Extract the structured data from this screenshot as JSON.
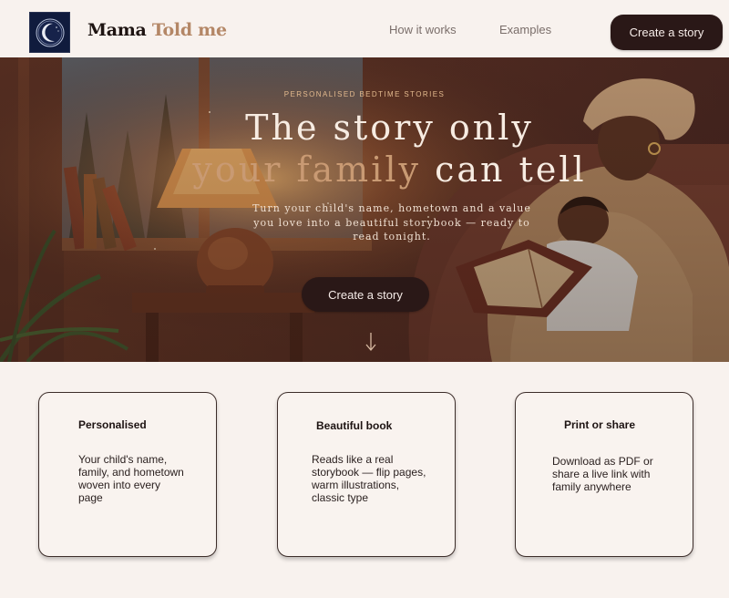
{
  "header": {
    "brand_part1": "Mama",
    "brand_part2": "Told me",
    "logo_icon": "crescent-moon-icon",
    "nav": [
      {
        "label": "How it works"
      },
      {
        "label": "Examples"
      }
    ],
    "cta_label": "Create a story"
  },
  "hero": {
    "eyebrow": "PERSONALISED BEDTIME STORIES",
    "headline_line1": "The story only",
    "headline_accent": "your family",
    "headline_rest": "can tell",
    "subtitle": "Turn your child's name, hometown and a value you love into a beautiful storybook — ready to read tonight.",
    "cta_label": "Create a story",
    "scroll_icon": "arrow-down-icon"
  },
  "features": [
    {
      "title": "Personalised",
      "text": "Your child's name, family, and hometown woven into every page"
    },
    {
      "title": "Beautiful book",
      "text": "Reads like a real storybook — flip pages, warm illustrations, classic type"
    },
    {
      "title": "Print or share",
      "text": "Download as PDF or share a live link with family anywhere"
    }
  ],
  "colors": {
    "background": "#f8f2ee",
    "button_dark": "#2a1817",
    "brand_accent": "#b48766"
  }
}
